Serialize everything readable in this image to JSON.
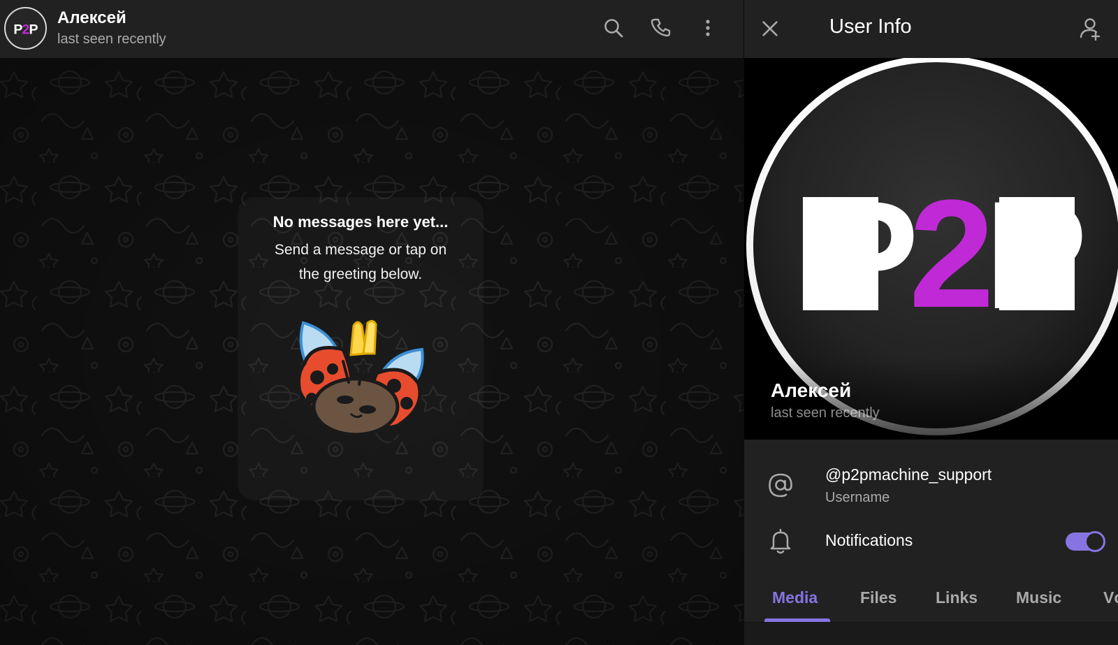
{
  "chat": {
    "header": {
      "name": "Алексей",
      "status": "last seen recently",
      "avatar_text": "P2P",
      "icons": [
        "search-icon",
        "phone-icon",
        "more-vertical-icon"
      ]
    },
    "empty_state": {
      "title": "No messages here yet...",
      "description_lines": [
        "Send a message or tap on",
        "the greeting below."
      ],
      "sticker": "ladybug-sticker"
    }
  },
  "info": {
    "title": "User Info",
    "icons": [
      "close-icon",
      "add-contact-icon"
    ],
    "profile": {
      "name": "Алексей",
      "status": "last seen recently",
      "avatar_text": "P2P"
    },
    "username": {
      "value": "@p2pmachine_support",
      "label": "Username",
      "icon": "at-sign-icon"
    },
    "notifications": {
      "label": "Notifications",
      "icon": "bell-icon",
      "enabled": true
    },
    "tabs": [
      {
        "label": "Media",
        "active": true
      },
      {
        "label": "Files",
        "active": false
      },
      {
        "label": "Links",
        "active": false
      },
      {
        "label": "Music",
        "active": false
      },
      {
        "label": "Vc",
        "active": false
      }
    ]
  },
  "colors": {
    "accent": "#8774e1",
    "header_bg": "#212121",
    "chat_bg": "#0e0e0e",
    "logo_magenta": "#c02ad6",
    "secondary_text": "#aaaaaa"
  }
}
